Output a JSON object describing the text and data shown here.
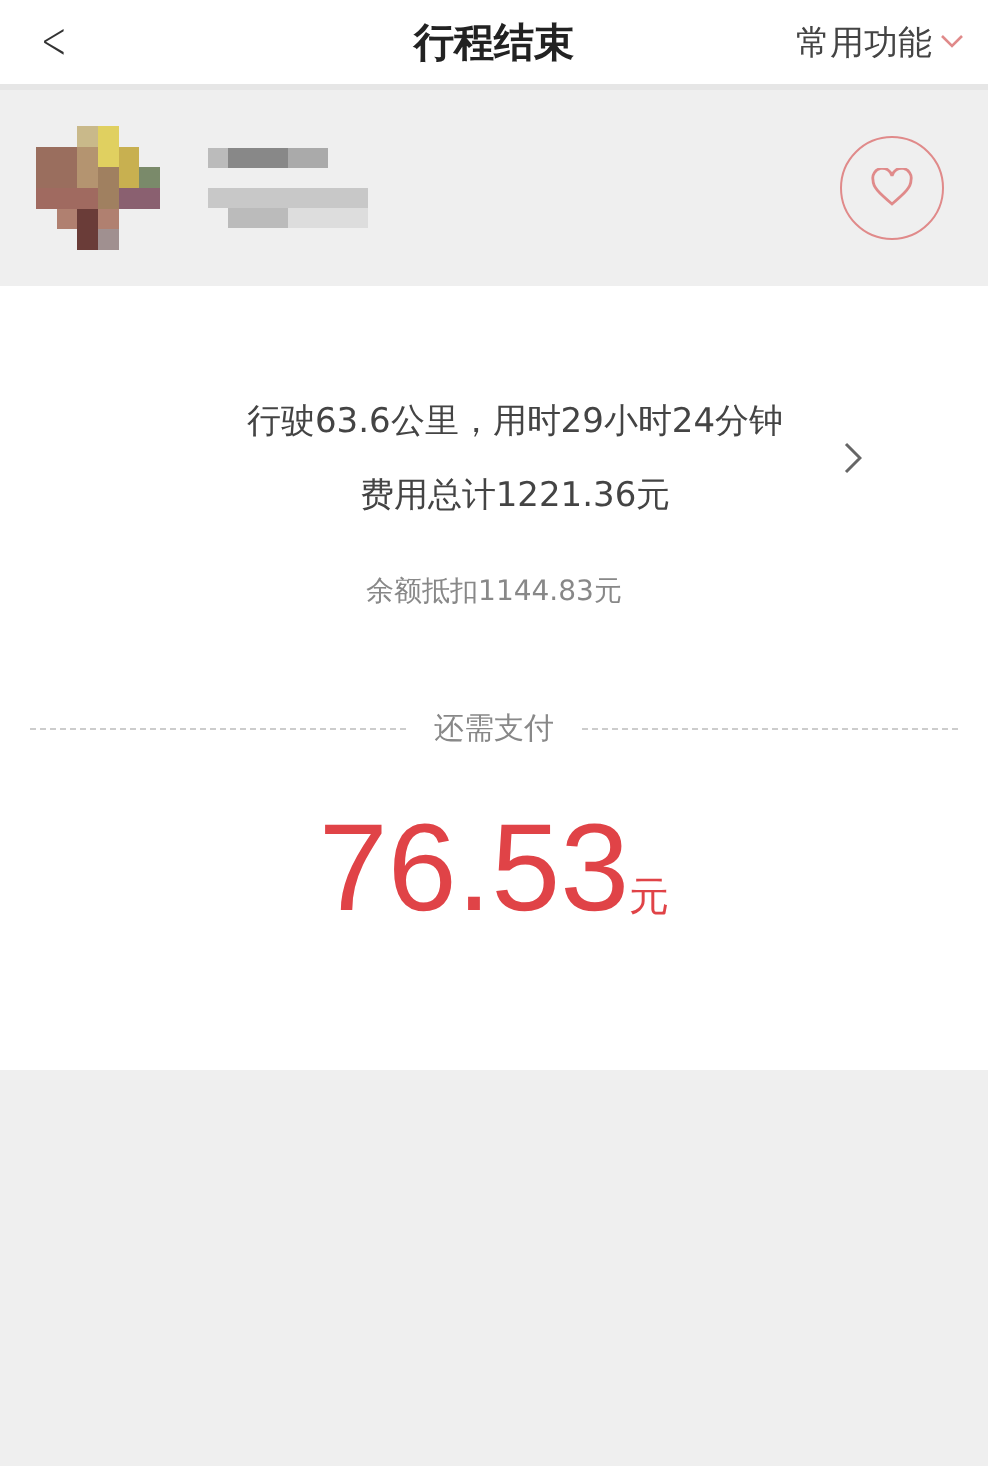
{
  "nav": {
    "back": "<",
    "title": "行程结束",
    "menu": "常用功能"
  },
  "driver": {
    "favorite": false
  },
  "trip": {
    "summary": "行驶63.6公里，用时29小时24分钟",
    "total": "费用总计1221.36元",
    "deduction": "余额抵扣1144.83元"
  },
  "payment": {
    "label": "还需支付",
    "amount": "76.53",
    "unit": "元"
  }
}
